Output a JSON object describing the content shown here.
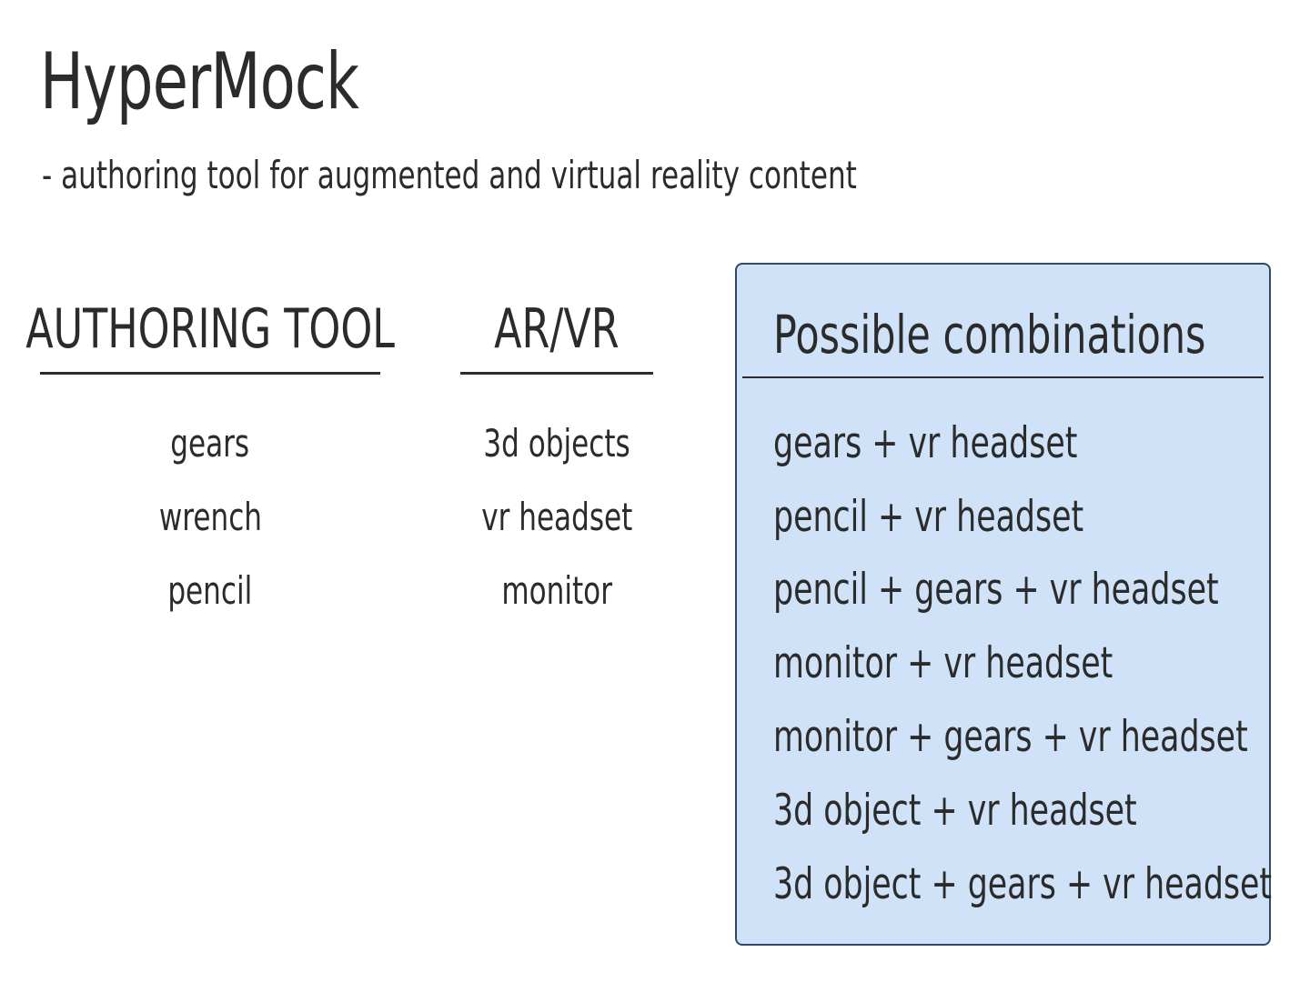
{
  "header": {
    "title": "HyperMock",
    "subtitle": "- authoring tool for augmented and virtual reality content"
  },
  "authoring_tool": {
    "heading": "AUTHORING TOOL",
    "items": [
      "gears",
      "wrench",
      "pencil"
    ]
  },
  "ar_vr": {
    "heading": "AR/VR",
    "items": [
      "3d objects",
      "vr headset",
      "monitor"
    ]
  },
  "combinations": {
    "heading": "Possible combinations",
    "items": [
      "gears + vr headset",
      "pencil + vr headset",
      "pencil + gears + vr headset",
      "monitor + vr headset",
      "monitor + gears + vr headset",
      "3d object + vr headset",
      "3d object + gears + vr headset"
    ]
  },
  "colors": {
    "panel_background": "#cfe2f7",
    "panel_border": "#30486a",
    "text": "#2b2b2b"
  }
}
